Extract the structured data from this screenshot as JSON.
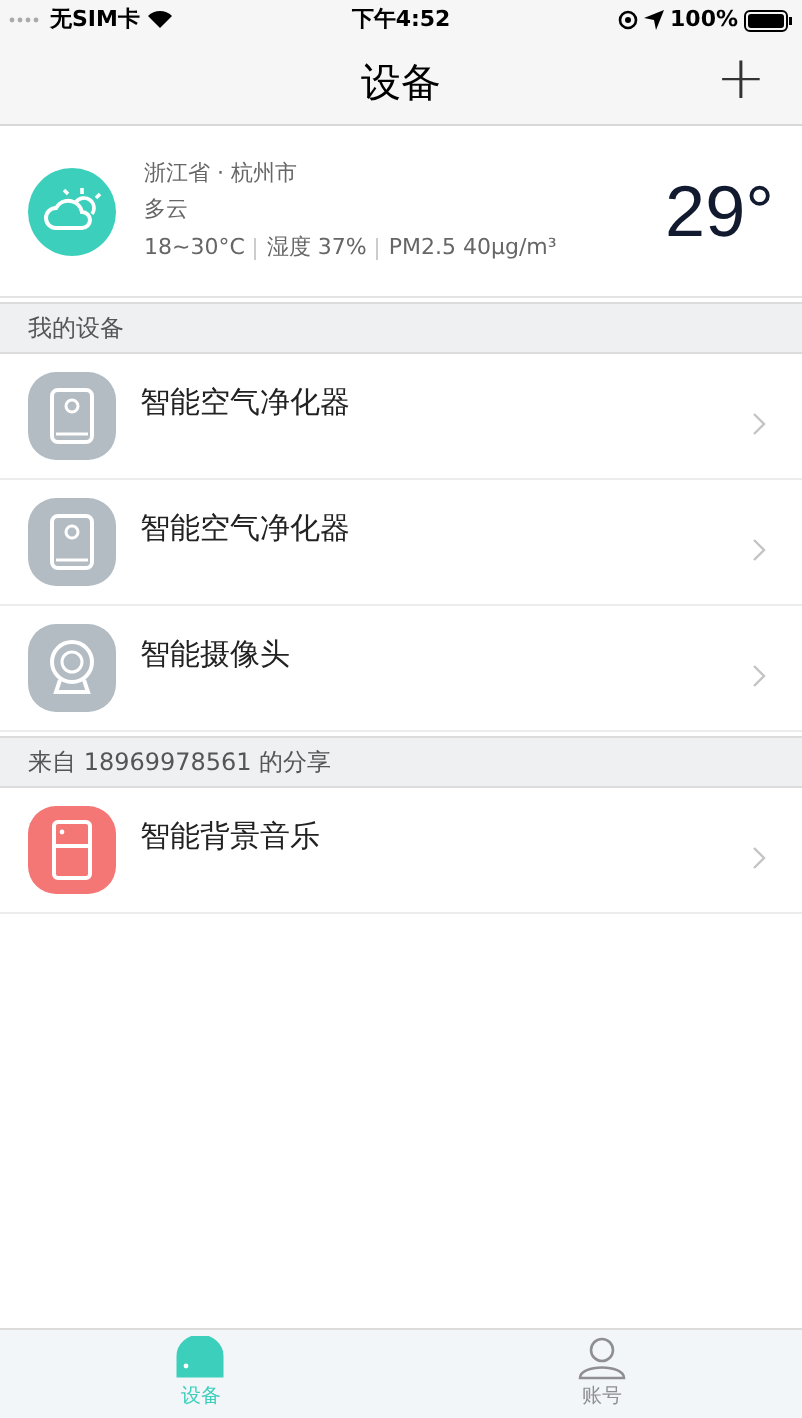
{
  "status_bar": {
    "carrier": "无SIM卡",
    "time": "下午4:52",
    "battery": "100%"
  },
  "nav": {
    "title": "设备",
    "add": "+"
  },
  "weather": {
    "location": "浙江省 · 杭州市",
    "condition": "多云",
    "range": "18~30°C",
    "humidity": "湿度 37%",
    "pm": "PM2.5 40μg/m³",
    "temperature": "29°"
  },
  "sections": [
    {
      "title": "我的设备",
      "devices": [
        {
          "name": "智能空气净化器",
          "kind": "purifier"
        },
        {
          "name": "智能空气净化器",
          "kind": "purifier"
        },
        {
          "name": "智能摄像头",
          "kind": "camera"
        }
      ]
    },
    {
      "title": "来自 18969978561 的分享",
      "devices": [
        {
          "name": "智能背景音乐",
          "kind": "music"
        }
      ]
    }
  ],
  "tabs": [
    {
      "label": "设备",
      "kind": "device",
      "selected": true
    },
    {
      "label": "账号",
      "kind": "account",
      "selected": false
    }
  ]
}
